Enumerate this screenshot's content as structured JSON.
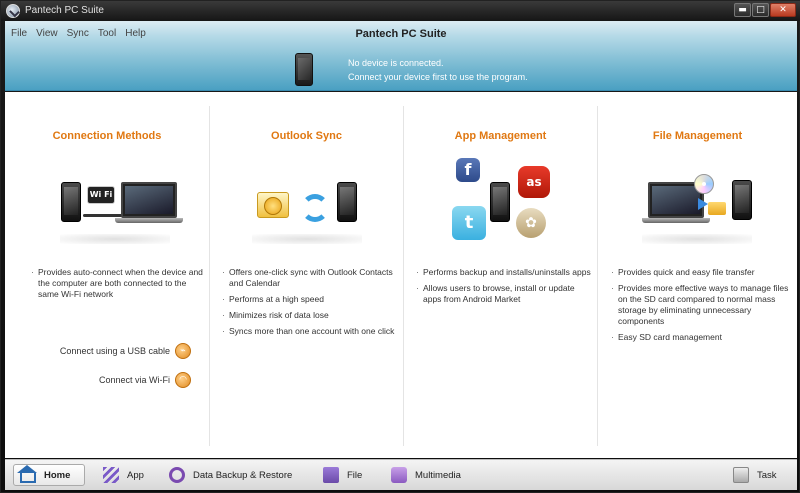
{
  "window": {
    "title": "Pantech PC Suite",
    "controls": {
      "minimize": "▬",
      "maximize": "□",
      "close": "✕"
    }
  },
  "header": {
    "title": "Pantech PC Suite",
    "menu": [
      "File",
      "View",
      "Sync",
      "Tool",
      "Help"
    ],
    "status_line1": "No device is connected.",
    "status_line2": "Connect your device first to use the program."
  },
  "panels": [
    {
      "title": "Connection Methods",
      "illustration_label": "Wi Fi",
      "bullets": [
        "Provides auto-connect when the device and the computer are both connected to the same Wi-Fi network"
      ],
      "links": [
        {
          "label": "Connect using a USB cable",
          "icon": "usb-icon",
          "glyph": "⌁"
        },
        {
          "label": "Connect via Wi-Fi",
          "icon": "wifi-icon",
          "glyph": "◠"
        }
      ]
    },
    {
      "title": "Outlook Sync",
      "bullets": [
        "Offers one-click sync with Outlook Contacts and Calendar",
        "Performs at a high speed",
        "Minimizes risk of data lose",
        "Syncs more than one account with one click"
      ]
    },
    {
      "title": "App Management",
      "tiles": [
        "f",
        "as",
        "t",
        "✿"
      ],
      "bullets": [
        "Performs backup and installs/uninstalls apps",
        "Allows users to browse, install or update apps from Android Market"
      ]
    },
    {
      "title": "File Management",
      "bullets": [
        "Provides quick and easy file transfer",
        "Provides more effective ways to manage files on the SD card compared to normal mass storage by eliminating unnecessary components",
        "Easy SD card management"
      ]
    }
  ],
  "tabs": {
    "home": "Home",
    "app": "App",
    "backup": "Data Backup & Restore",
    "file": "File",
    "multimedia": "Multimedia",
    "task": "Task"
  },
  "colors": {
    "accent_orange": "#e07812",
    "header_blue": "#4aa0c2"
  }
}
